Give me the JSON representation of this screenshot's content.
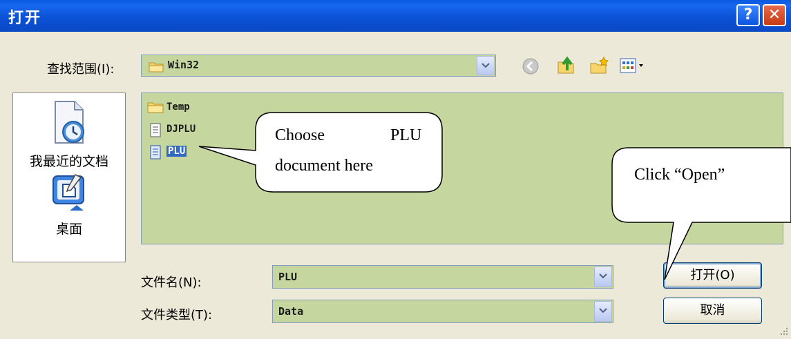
{
  "window": {
    "title": "打开",
    "help_glyph": "?",
    "close_glyph": "✕"
  },
  "lookin": {
    "label": "查找范围(I):",
    "value": "Win32"
  },
  "sidebar": {
    "items": [
      {
        "label": "我最近的文档",
        "icon": "recent-documents-icon"
      },
      {
        "label": "桌面",
        "icon": "desktop-icon"
      }
    ]
  },
  "files": [
    {
      "name": "Temp",
      "type": "folder",
      "selected": false
    },
    {
      "name": "DJPLU",
      "type": "file",
      "selected": false
    },
    {
      "name": "PLU",
      "type": "file",
      "selected": true
    }
  ],
  "filename": {
    "label": "文件名(N):",
    "value": "PLU"
  },
  "filetype": {
    "label": "文件类型(T):",
    "value": "Data"
  },
  "buttons": {
    "open": "打开(O)",
    "cancel": "取消"
  },
  "callouts": {
    "choose_line1": "Choose",
    "choose_line2": "PLU",
    "choose_line3": "document here",
    "open_hint": "Click “Open”"
  },
  "colors": {
    "titlebar": "#0a52d6",
    "field_bg": "#c5d69f",
    "selection": "#316ac5"
  }
}
